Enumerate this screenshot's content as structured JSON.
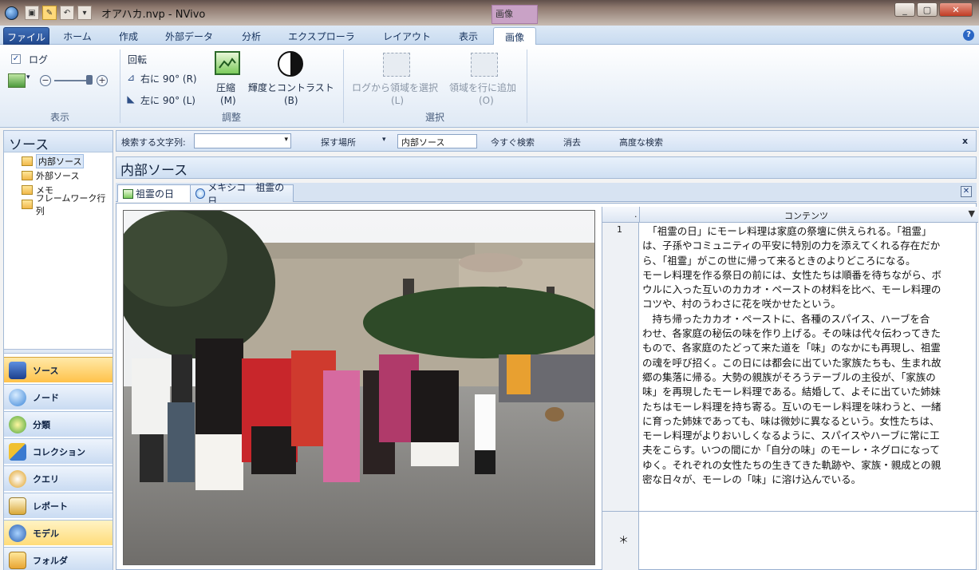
{
  "window": {
    "title": "オアハカ.nvp - NVivo",
    "context_tab_group": "画像",
    "minimize": "_",
    "maximize": "▢",
    "close": "✕"
  },
  "qat": {
    "undo": "↶",
    "more": "▾"
  },
  "ribbon_tabs": [
    "ファイル",
    "ホーム",
    "作成",
    "外部データ",
    "分析",
    "エクスプローラ",
    "レイアウト",
    "表示",
    "画像"
  ],
  "active_tab": "画像",
  "ribbon": {
    "view_group": {
      "log_checkbox": "ログ",
      "log_checked": "✓",
      "label": "表示",
      "zoom_minus": "−",
      "zoom_plus": "+"
    },
    "adjust_group": {
      "rotate": "回転",
      "rotate_right": "右に 90° (R)",
      "rotate_left": "左に 90° (L)",
      "compress": "圧縮",
      "compress_key": "(M)",
      "brightness": "輝度とコントラスト",
      "brightness_key": "(B)",
      "label": "調整"
    },
    "select_group": {
      "select_region_from_log": "ログから領域を選択",
      "select_region_key": "(L)",
      "add_region_to_row": "領域を行に追加",
      "add_region_key": "(O)",
      "label": "選択"
    }
  },
  "sources_panel": {
    "title": "ソース",
    "items": [
      "内部ソース",
      "外部ソース",
      "メモ",
      "フレームワーク行列"
    ],
    "selected": "内部ソース"
  },
  "nav_buttons": [
    "ソース",
    "ノード",
    "分類",
    "コレクション",
    "クエリ",
    "レポート",
    "モデル",
    "フォルダ"
  ],
  "nav_active": "ソース",
  "find_bar": {
    "search_label": "検索する文字列:",
    "search_value": "",
    "look_in_label": "探す場所",
    "look_in_value": "内部ソース",
    "find_now": "今すぐ検索",
    "clear": "消去",
    "advanced": "高度な検索",
    "close": "x"
  },
  "section_title": "内部ソース",
  "doc_tabs": [
    "祖霊の日",
    "メキシコ　祖霊の日"
  ],
  "active_doc_tab": "祖霊の日",
  "log_grid": {
    "column_header_dot": ".",
    "column_header": "コンテンツ",
    "filter_icon": "filter-icon",
    "rows": [
      {
        "num": "1",
        "lines": [
          "　「祖霊の日」にモーレ料理は家庭の祭壇に供えられる。「祖霊」",
          "は、子孫やコミュニティの平安に特別の力を添えてくれる存在だか",
          "ら、「祖霊」がこの世に帰って来るときのよりどころになる。",
          "モーレ料理を作る祭日の前には、女性たちは順番を待ちながら、ボ",
          "ウルに入った互いのカカオ・ペーストの材料を比べ、モーレ料理の",
          "コツや、村のうわさに花を咲かせたという。",
          "　持ち帰ったカカオ・ペーストに、各種のスパイス、ハーブを合",
          "わせ、各家庭の秘伝の味を作り上げる。その味は代々伝わってきた",
          "もので、各家庭のたどって来た道を「味」のなかにも再現し、祖霊",
          "の魂を呼び招く。この日には都会に出ていた家族たちも、生まれ故",
          "郷の集落に帰る。大勢の親族がそろうテーブルの主役が、「家族の",
          "味」を再現したモーレ料理である。結婚して、よそに出ていた姉妹",
          "たちはモーレ料理を持ち寄る。互いのモーレ料理を味わうと、一緒",
          "に育った姉妹であっても、味は微妙に異なるという。女性たちは、",
          "モーレ料理がよりおいしくなるように、スパイスやハーブに常に工",
          "夫をこらす。いつの間にか「自分の味」のモーレ・ネグロになって",
          "ゆく。それぞれの女性たちの生きてきた軌跡や、家族・親成との親",
          "密な日々が、モーレの「味」に溶け込んでいる。"
        ]
      }
    ],
    "new_row_marker": "＊"
  },
  "colors": {
    "accent": "#21488d",
    "active_nav": "#ffc24a",
    "context_tab": "#c9a2c6"
  }
}
